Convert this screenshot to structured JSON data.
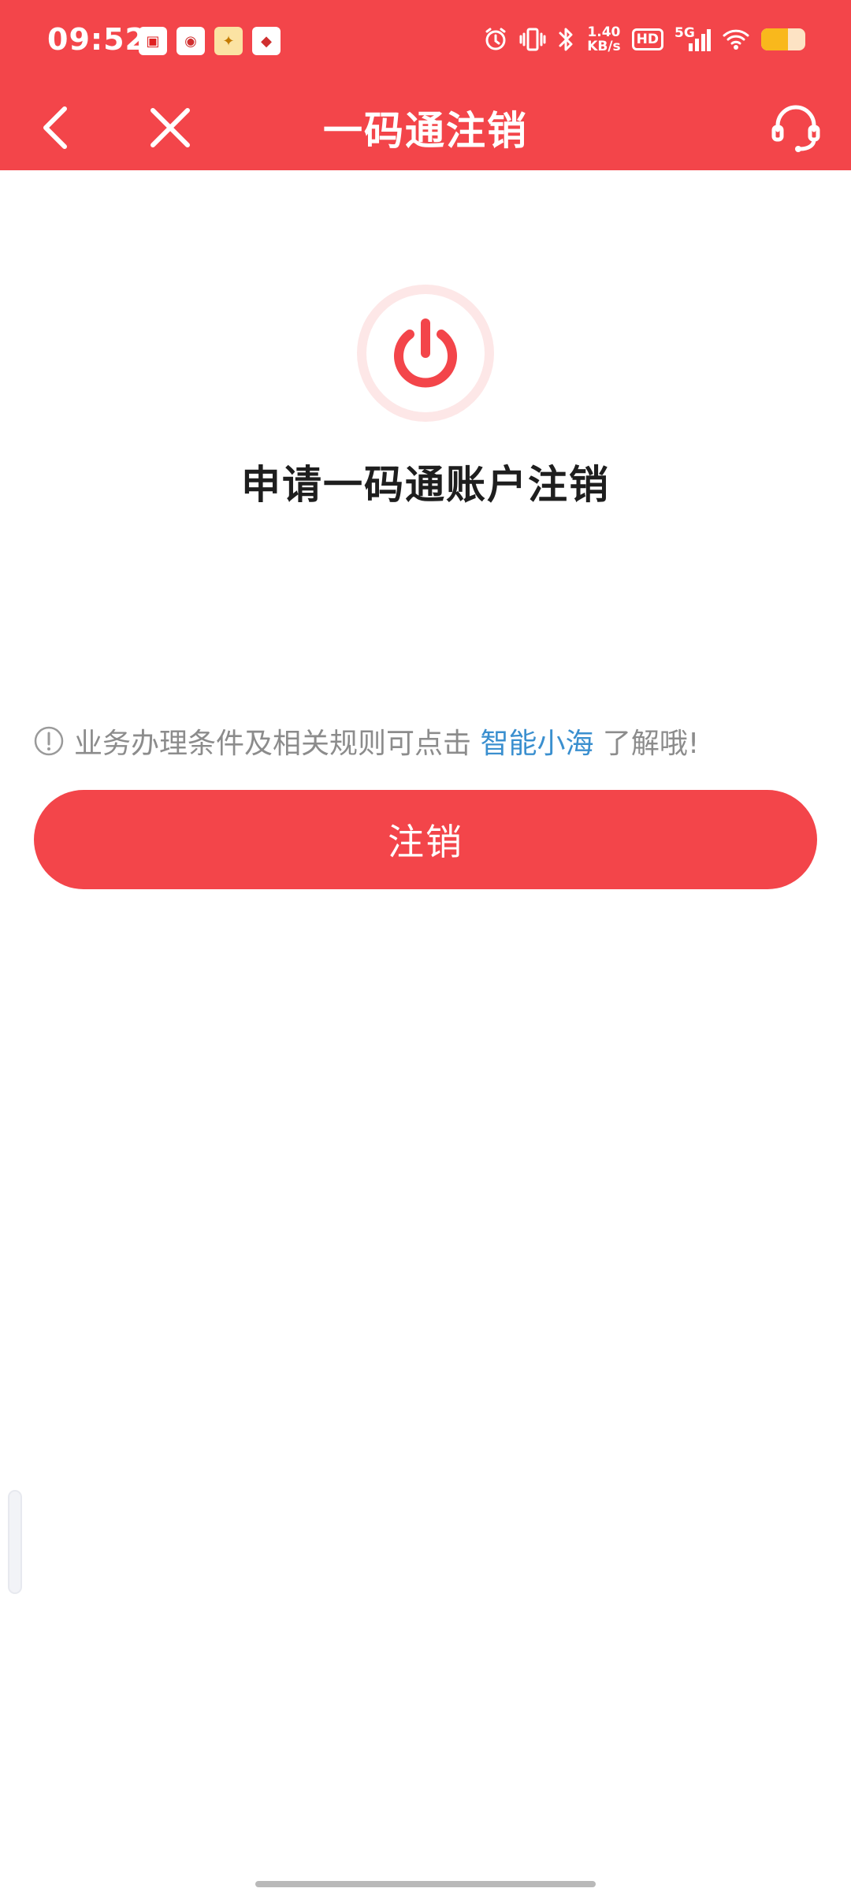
{
  "status_bar": {
    "time": "09:52",
    "net_speed_value": "1.40",
    "net_speed_unit": "KB/s",
    "hd_label": "HD",
    "network_label": "5G"
  },
  "nav": {
    "title": "一码通注销",
    "back_icon": "chevron-left-icon",
    "close_icon": "close-icon",
    "service_icon": "headset-icon"
  },
  "main": {
    "power_icon": "power-icon",
    "heading": "申请一码通账户注销",
    "notice": {
      "prefix": "业务办理条件及相关规则可点击 ",
      "link": "智能小海",
      "suffix": " 了解哦!"
    },
    "cancel_button": "注销"
  },
  "colors": {
    "brand_red": "#f3454a",
    "link_blue": "#3a8fcf",
    "notice_gray": "#8c8c8c"
  }
}
